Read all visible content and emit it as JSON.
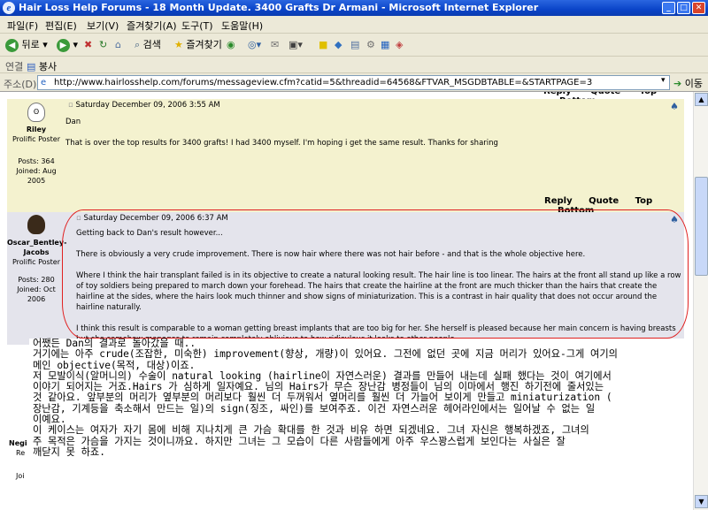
{
  "window": {
    "title": "Hair Loss Help Forums - 18 Month Update. 3400 Grafts Dr Armani - Microsoft Internet Explorer"
  },
  "menu": [
    "파일(F)",
    "편집(E)",
    "보기(V)",
    "즐겨찾기(A)",
    "도구(T)",
    "도움말(H)"
  ],
  "toolbar": {
    "back": "뒤로",
    "search": "검색",
    "favorites": "즐겨찾기"
  },
  "links": {
    "label": "연결",
    "item": "봉사"
  },
  "address": {
    "label": "주소(D)",
    "url": "http://www.hairlosshelp.com/forums/messageview.cfm?catid=5&threadid=64568&FTVAR_MSGDBTABLE=&STARTPAGE=3",
    "go": "이동"
  },
  "actions": {
    "reply": "Reply",
    "quote": "Quote",
    "top": "Top",
    "bottom": "Bottom"
  },
  "posts": [
    {
      "author": "Riley",
      "rank": "Prolific Poster",
      "posts": "Posts: 364",
      "joined": "Joined: Aug 2005",
      "date": "Saturday December 09, 2006 3:55 AM",
      "lines": [
        "Dan",
        "That is over the top results for 3400 grafts! I had 3400 myself. I'm hoping i get the same result. Thanks for sharing"
      ]
    },
    {
      "author": "Oscar_Bentley-Jacobs",
      "rank": "Prolific Poster",
      "posts": "Posts: 280",
      "joined": "Joined: Oct 2006",
      "date": "Saturday December 09, 2006 6:37 AM",
      "lines": [
        "Getting back to Dan's result however...",
        "There is obviously a very crude improvement. There is now hair where there was not hair before - and that is the whole objective here.",
        "Where I think the hair transplant failed is in its objective to create a natural looking result. The hair line is too linear. The hairs at the front all stand up like a row of toy soldiers being prepared to march down your forehead. The hairs that create the hairline at the front are much thicker than the hairs that create the hairline at the sides, where the hairs look much thinner and show signs of miniaturization. This is a contrast in hair quality that does not occur around the hairline naturally.",
        "I think this result is comparable to a woman getting breast implants that are too big for her. She herself is pleased because her main concern is having breasts but she somehow manages to remain completely oblivious to how ridiculous it looks to other people."
      ]
    }
  ],
  "partial_author": {
    "a": "Negi",
    "b": "Re",
    "c": "Joi"
  },
  "translation": [
    "어쨌든 Dan의 결과로 돌아갔을 때..",
    "거기에는 아주 crude(조잡한, 미숙한) improvement(향상, 개량)이 있어요. 그전에 없던 곳에 지금 머리가 있어요-그게 여기의",
    "메인 objective(목적, 대상)이죠.",
    "저 모발이식(알머니의) 수술이 natural looking (hairline이 자연스러운) 결과를 만들어 내는데 실패 했다는 것이 여기에서",
    "이야기 되어지는 거죠.Hairs 가 심하게 일자예요. 님의 Hairs가 무슨 장난감 병정들이 님의 이마에서 행진 하기전에 줄서있는",
    "것 같아요. 앞부분의 머리가 옆부분의 머리보다 훨씬 더 두꺼워서 옆머리를 훨씬 더 가늘어 보이게 만들고 miniaturization (",
    "장난감, 기계등을 축소해서 만드는 일)의 sign(징조, 싸인)를 보여주죠. 이건 자연스러운 헤어라인에서는 일어날 수 없는 일",
    "이예요.",
    "이 케이스는 여자가 자기 몸에 비해 지나치게 큰 가슴 확대를 한 것과 비유 하면 되겠네요. 그녀 자신은 행복하겠죠, 그녀의",
    "주 목적은 가슴을 가지는 것이니까요. 하지만 그녀는 그 모습이 다른 사람들에게 아주 우스꽝스럽게 보인다는 사실은 잘",
    "깨닫지 못 하죠."
  ]
}
